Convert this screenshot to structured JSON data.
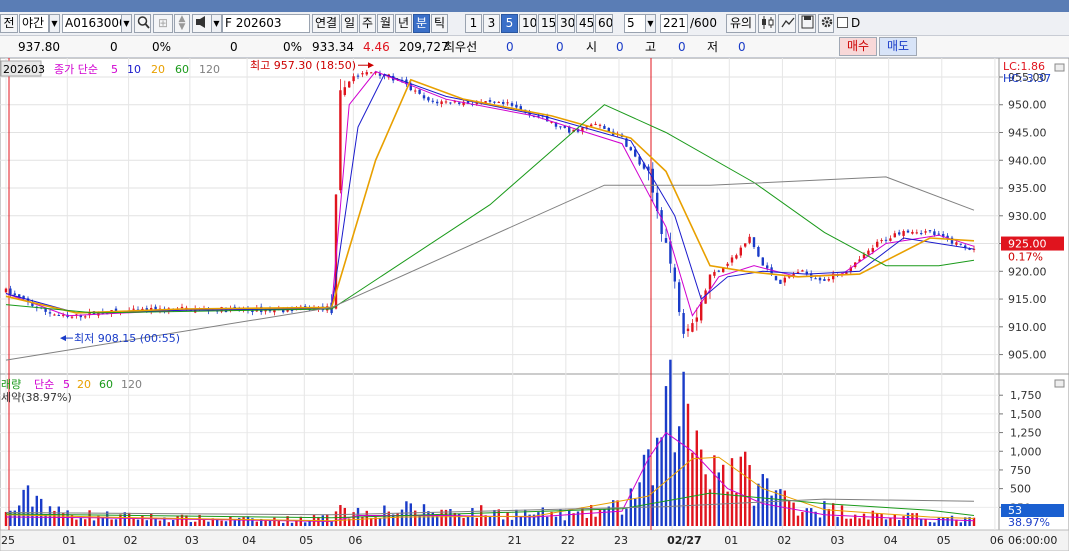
{
  "toolbar": {
    "session_partial": "전",
    "session_select": "야간",
    "symbol_code": "A0163000",
    "contract": "F 202603",
    "linked_label": "연결",
    "period_buttons": [
      "일",
      "주",
      "월",
      "년",
      "분",
      "틱"
    ],
    "active_period": "분",
    "interval_buttons": [
      "1",
      "3",
      "5",
      "10",
      "15",
      "30",
      "45",
      "60"
    ],
    "active_interval": "5",
    "interval_select": "5",
    "count_value": "221",
    "count_total": "/600",
    "caution_label": "유의",
    "checkbox_label": "D"
  },
  "infobar": {
    "price": "937.80",
    "v1": "0",
    "v1_pct": "0%",
    "v2": "0",
    "v2_pct": "0%",
    "current": "933.34",
    "change": "4.46",
    "volume": "209,727",
    "best_label": "최우선",
    "best_val": "0",
    "best_val2": "0",
    "open_label": "시",
    "open_val": "0",
    "high_label": "고",
    "high_val": "0",
    "low_label": "저",
    "low_val": "0",
    "buy_label": "매수",
    "sell_label": "매도"
  },
  "colors": {
    "up": "#e0141e",
    "down": "#1a3cc8",
    "ma5": "#d000d0",
    "ma10": "#1a1acc",
    "ma20": "#e8a000",
    "ma60": "#1a9a1a",
    "ma120": "#808080",
    "price_tag": "#e0141e",
    "vol_tag": "#1a5fd0"
  },
  "chart_data": [
    {
      "type": "candlestick",
      "legend": {
        "contract": "202603",
        "title": "종가 단순",
        "periods": [
          "5",
          "10",
          "20",
          "60",
          "120"
        ]
      },
      "y_ticks": [
        "955.00",
        "950.00",
        "945.00",
        "940.00",
        "935.00",
        "930.00",
        "925.00",
        "920.00",
        "915.00",
        "910.00",
        "905.00"
      ],
      "ylim": [
        901.5,
        957.7
      ],
      "corner_labels": [
        "LC:1.86",
        "HC:-3.37"
      ],
      "current_price": "925.00",
      "current_change": "0.17%",
      "max_annotation": {
        "text": "최고 957.30 (18:50)",
        "value": 957.3
      },
      "min_annotation": {
        "text": "최저 908.15 (00:55)",
        "value": 908.15
      },
      "trend": [
        {
          "i": 0,
          "v": 916.5
        },
        {
          "i": 8,
          "v": 913.0
        },
        {
          "i": 14,
          "v": 911.6
        },
        {
          "i": 20,
          "v": 912.5
        },
        {
          "i": 40,
          "v": 913.2
        },
        {
          "i": 60,
          "v": 913.0
        },
        {
          "i": 74,
          "v": 913.4
        },
        {
          "i": 76,
          "v": 951.5
        },
        {
          "i": 78,
          "v": 955.0
        },
        {
          "i": 84,
          "v": 956.0
        },
        {
          "i": 90,
          "v": 954.0
        },
        {
          "i": 96,
          "v": 950.5
        },
        {
          "i": 102,
          "v": 950.5
        },
        {
          "i": 114,
          "v": 950.0
        },
        {
          "i": 122,
          "v": 947.5
        },
        {
          "i": 128,
          "v": 945.0
        },
        {
          "i": 134,
          "v": 946.5
        },
        {
          "i": 140,
          "v": 944.0
        },
        {
          "i": 146,
          "v": 937.0
        },
        {
          "i": 150,
          "v": 925.0
        },
        {
          "i": 154,
          "v": 910.0
        },
        {
          "i": 157,
          "v": 912.5
        },
        {
          "i": 160,
          "v": 919.0
        },
        {
          "i": 163,
          "v": 921.0
        },
        {
          "i": 166,
          "v": 923.0
        },
        {
          "i": 169,
          "v": 926.0
        },
        {
          "i": 172,
          "v": 921.0
        },
        {
          "i": 176,
          "v": 918.0
        },
        {
          "i": 180,
          "v": 920.0
        },
        {
          "i": 186,
          "v": 918.5
        },
        {
          "i": 192,
          "v": 920.5
        },
        {
          "i": 198,
          "v": 925.0
        },
        {
          "i": 204,
          "v": 927.5
        },
        {
          "i": 210,
          "v": 927.0
        },
        {
          "i": 216,
          "v": 925.0
        },
        {
          "i": 220,
          "v": 924.0
        }
      ],
      "ma_series": [
        {
          "period": "5",
          "points": [
            [
              0,
              916
            ],
            [
              14,
              912
            ],
            [
              40,
              913
            ],
            [
              74,
              913.3
            ],
            [
              78,
              950
            ],
            [
              84,
              956
            ],
            [
              100,
              951
            ],
            [
              120,
              948
            ],
            [
              140,
              943
            ],
            [
              150,
              928
            ],
            [
              156,
              912
            ],
            [
              162,
              919
            ],
            [
              170,
              921
            ],
            [
              180,
              919
            ],
            [
              190,
              919.5
            ],
            [
              200,
              925
            ],
            [
              212,
              926.5
            ],
            [
              220,
              924.5
            ]
          ]
        },
        {
          "period": "10",
          "points": [
            [
              0,
              916
            ],
            [
              16,
              912.5
            ],
            [
              40,
              913
            ],
            [
              74,
              913.3
            ],
            [
              80,
              946
            ],
            [
              86,
              955.5
            ],
            [
              100,
              951.5
            ],
            [
              122,
              948
            ],
            [
              142,
              943.5
            ],
            [
              152,
              930
            ],
            [
              158,
              915
            ],
            [
              164,
              919
            ],
            [
              172,
              920
            ],
            [
              182,
              919.5
            ],
            [
              194,
              920
            ],
            [
              204,
              926
            ],
            [
              220,
              924
            ]
          ]
        },
        {
          "period": "20",
          "points": [
            [
              0,
              915.5
            ],
            [
              16,
              912.5
            ],
            [
              40,
              913.2
            ],
            [
              74,
              913.5
            ],
            [
              84,
              940
            ],
            [
              92,
              954.5
            ],
            [
              104,
              951
            ],
            [
              124,
              948
            ],
            [
              142,
              944
            ],
            [
              150,
              938
            ],
            [
              160,
              921
            ],
            [
              168,
              920
            ],
            [
              180,
              919
            ],
            [
              194,
              919.5
            ],
            [
              210,
              926
            ],
            [
              220,
              925.5
            ]
          ]
        },
        {
          "period": "60",
          "points": [
            [
              0,
              914
            ],
            [
              20,
              912.5
            ],
            [
              74,
              913.2
            ],
            [
              110,
              932
            ],
            [
              136,
              950
            ],
            [
              150,
              945
            ],
            [
              170,
              936
            ],
            [
              186,
              927
            ],
            [
              200,
              921
            ],
            [
              212,
              921
            ],
            [
              220,
              922
            ]
          ]
        },
        {
          "period": "120",
          "points": [
            [
              0,
              904
            ],
            [
              74,
              913.5
            ],
            [
              136,
              935.5
            ],
            [
              160,
              935.5
            ],
            [
              200,
              937
            ],
            [
              220,
              931
            ]
          ]
        }
      ]
    },
    {
      "type": "bar",
      "legend": {
        "title_partial": "래량",
        "ma_label": "단순",
        "periods": [
          "5",
          "20",
          "60",
          "120"
        ],
        "contract_partial": "세약(38.97%)"
      },
      "y_ticks": [
        "1,750",
        "1,500",
        "1,250",
        "1,000",
        "750",
        "500",
        "250"
      ],
      "ylim": [
        0,
        1900
      ],
      "current_value": "53",
      "current_pct": "38.97%",
      "volume_profile": [
        [
          0,
          150
        ],
        [
          6,
          420
        ],
        [
          12,
          180
        ],
        [
          20,
          140
        ],
        [
          40,
          100
        ],
        [
          60,
          80
        ],
        [
          74,
          110
        ],
        [
          76,
          420
        ],
        [
          78,
          180
        ],
        [
          90,
          220
        ],
        [
          110,
          180
        ],
        [
          130,
          150
        ],
        [
          140,
          260
        ],
        [
          146,
          700
        ],
        [
          150,
          1250
        ],
        [
          152,
          1800
        ],
        [
          156,
          1300
        ],
        [
          160,
          900
        ],
        [
          170,
          600
        ],
        [
          180,
          280
        ],
        [
          190,
          200
        ],
        [
          200,
          130
        ],
        [
          212,
          100
        ],
        [
          220,
          80
        ]
      ],
      "ma_series": [
        {
          "period": "5",
          "points": [
            [
              0,
              120
            ],
            [
              20,
              110
            ],
            [
              74,
              60
            ],
            [
              80,
              140
            ],
            [
              100,
              140
            ],
            [
              120,
              120
            ],
            [
              140,
              200
            ],
            [
              146,
              900
            ],
            [
              150,
              1250
            ],
            [
              156,
              1000
            ],
            [
              164,
              500
            ],
            [
              172,
              300
            ],
            [
              186,
              150
            ],
            [
              200,
              110
            ],
            [
              220,
              70
            ]
          ]
        },
        {
          "period": "20",
          "points": [
            [
              0,
              150
            ],
            [
              30,
              110
            ],
            [
              74,
              70
            ],
            [
              90,
              120
            ],
            [
              120,
              130
            ],
            [
              146,
              400
            ],
            [
              156,
              900
            ],
            [
              162,
              920
            ],
            [
              172,
              500
            ],
            [
              186,
              220
            ],
            [
              210,
              120
            ],
            [
              220,
              100
            ]
          ]
        },
        {
          "period": "60",
          "points": [
            [
              0,
              160
            ],
            [
              74,
              110
            ],
            [
              140,
              230
            ],
            [
              160,
              440
            ],
            [
              186,
              300
            ],
            [
              210,
              210
            ],
            [
              220,
              140
            ]
          ]
        },
        {
          "period": "120",
          "points": [
            [
              0,
              180
            ],
            [
              74,
              150
            ],
            [
              150,
              260
            ],
            [
              186,
              360
            ],
            [
              220,
              330
            ]
          ]
        }
      ]
    }
  ],
  "x_axis": {
    "labels": [
      {
        "i": 0,
        "t": "25"
      },
      {
        "i": 15,
        "t": "01"
      },
      {
        "i": 30,
        "t": "02"
      },
      {
        "i": 45,
        "t": "03"
      },
      {
        "i": 59,
        "t": "04"
      },
      {
        "i": 73,
        "t": "05"
      },
      {
        "i": 85,
        "t": "06"
      },
      {
        "i": 124,
        "t": "21"
      },
      {
        "i": 137,
        "t": "22"
      },
      {
        "i": 150,
        "t": "23"
      },
      {
        "i": 163,
        "t": "02/27"
      },
      {
        "i": 177,
        "t": "01"
      },
      {
        "i": 190,
        "t": "02"
      },
      {
        "i": 203,
        "t": "03"
      },
      {
        "i": 216,
        "t": "04"
      },
      {
        "i": 229,
        "t": "05"
      },
      {
        "i": 242,
        "t": "06"
      }
    ],
    "right_label": "06:00:00"
  }
}
